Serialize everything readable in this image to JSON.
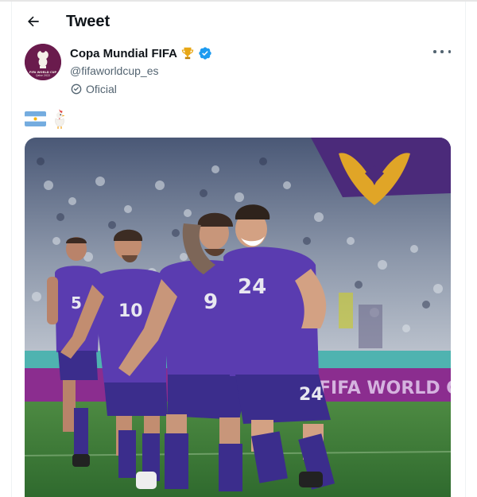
{
  "header": {
    "title": "Tweet",
    "back_icon": "arrow-left-icon"
  },
  "tweet": {
    "author": {
      "display_name": "Copa Mundial FIFA",
      "name_emoji": "trophy-icon",
      "verified_icon": "verified-badge-icon",
      "handle": "@fifaworldcup_es",
      "label": "Oficial",
      "label_icon": "checkmark-circle-icon",
      "avatar_text": "FIFA WORLD CUP Qatar 2022"
    },
    "content_emojis": [
      "argentina-flag-icon",
      "rooster-icon"
    ],
    "media": {
      "kind": "photo",
      "jersey_numbers": [
        "5",
        "10",
        "9",
        "24",
        "24"
      ],
      "board_text": "FIFA WORLD CUP"
    }
  },
  "colors": {
    "verified": "#1d9bf0",
    "secondary_text": "#536471",
    "jersey": "#5a3cb0",
    "pitch": "#3f7b3a",
    "board": "#8b2d8f"
  }
}
